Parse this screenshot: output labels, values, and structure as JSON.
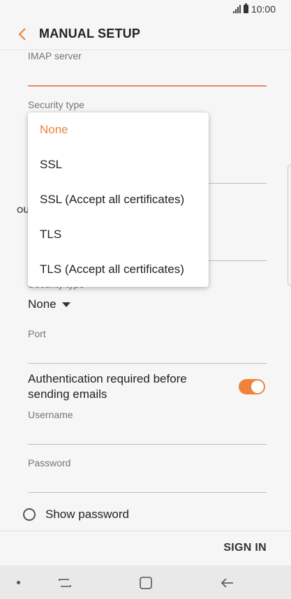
{
  "status_bar": {
    "time": "10:00"
  },
  "app_bar": {
    "title": "MANUAL SETUP"
  },
  "incoming": {
    "imap_server_label": "IMAP server",
    "imap_server_value": "",
    "security_type_label": "Security type"
  },
  "outgoing": {
    "section_partial": "OU",
    "security_type_label_partial": "Security type",
    "security_type_value": "None",
    "port_label": "Port",
    "port_value": "",
    "auth_label": "Authentication required before sending emails",
    "auth_enabled": true,
    "username_label": "Username",
    "username_value": "",
    "password_label": "Password",
    "password_value": "",
    "show_password_label": "Show password"
  },
  "bottom": {
    "sign_in_label": "SIGN IN"
  },
  "dropdown": {
    "selected_index": 0,
    "options": [
      "None",
      "SSL",
      "SSL (Accept all certificates)",
      "TLS",
      "TLS (Accept all certificates)"
    ]
  },
  "colors": {
    "accent": "#f0833b",
    "active_underline": "#f0836a"
  },
  "icons": {
    "back": "back-arrow-icon",
    "signal": "signal-icon",
    "battery": "battery-icon",
    "recents": "recents-icon",
    "home": "home-icon",
    "nav_back": "nav-back-icon"
  }
}
